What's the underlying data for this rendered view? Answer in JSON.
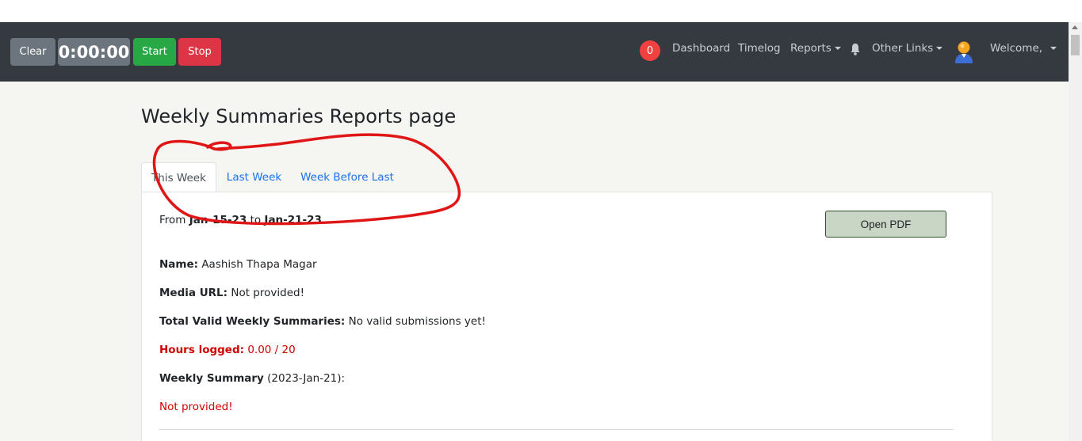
{
  "toolbar": {
    "clear_label": "Clear",
    "timer_value": "0:00:00",
    "start_label": "Start",
    "stop_label": "Stop"
  },
  "nav": {
    "notification_count": "0",
    "dashboard": "Dashboard",
    "timelog": "Timelog",
    "reports": "Reports",
    "other_links": "Other Links",
    "welcome": "Welcome,"
  },
  "page": {
    "title": "Weekly Summaries Reports page",
    "tabs": [
      {
        "label": "This Week",
        "active": true
      },
      {
        "label": "Last Week",
        "active": false
      },
      {
        "label": "Week Before Last",
        "active": false
      }
    ]
  },
  "report": {
    "from_prefix": "From ",
    "from_date": "Jan-15-23",
    "to_word": " to ",
    "to_date": "Jan-21-23",
    "open_pdf": "Open PDF",
    "name_label": "Name:",
    "name_value": " Aashish Thapa Magar",
    "media_label": "Media URL:",
    "media_value": " Not provided!",
    "total_label": "Total Valid Weekly Summaries:",
    "total_value": " No valid submissions yet!",
    "hours_label": "Hours logged:",
    "hours_value": " 0.00 / 20",
    "summary_label": "Weekly Summary",
    "summary_date": " (2023-Jan-21):",
    "summary_value": "Not provided!"
  },
  "colors": {
    "navbar": "#343a40",
    "start": "#28a745",
    "stop": "#dc3545",
    "link": "#1a73e8",
    "warning_red": "#d10000",
    "annotation": "#e01515"
  }
}
